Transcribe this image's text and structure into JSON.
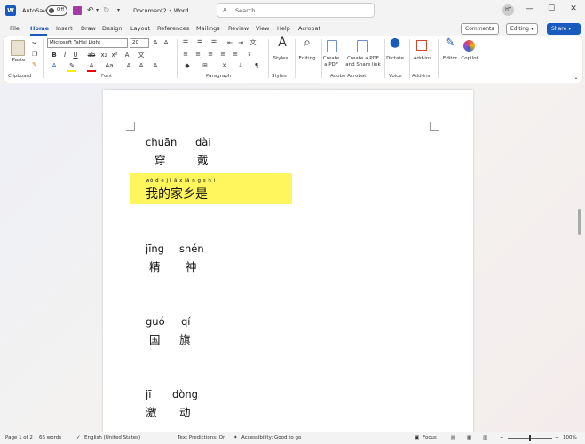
{
  "titlebar": {
    "autosave_label": "AutoSave",
    "autosave_state": "Off",
    "doc_title": "Document2 • Word",
    "search_placeholder": "Search",
    "user_initials": "HY",
    "minimize": "—",
    "restore": "☐",
    "close": "✕"
  },
  "tabs": [
    "File",
    "Home",
    "Insert",
    "Draw",
    "Design",
    "Layout",
    "References",
    "Mailings",
    "Review",
    "View",
    "Help",
    "Acrobat"
  ],
  "tabbar_buttons": {
    "comments": "Comments",
    "editing": "Editing",
    "share": "Share"
  },
  "ribbon": {
    "clipboard": {
      "paste": "Paste",
      "label": "Clipboard"
    },
    "font": {
      "name": "Microsoft YaHei Light",
      "size": "20",
      "label": "Font"
    },
    "paragraph": {
      "label": "Paragraph"
    },
    "styles": {
      "styles": "Styles",
      "label": "Styles"
    },
    "editing": {
      "editing": "Editing"
    },
    "acrobat": {
      "create_pdf_1": "Create",
      "create_pdf_2": "a PDF",
      "share_1": "Create a PDF",
      "share_2": "and Share link",
      "label": "Adobe Acrobat"
    },
    "voice": {
      "dictate": "Dictate",
      "label": "Voice"
    },
    "addins": {
      "addins": "Add-ins",
      "label": "Add-ins"
    },
    "editor": "Editor",
    "copilot": "Copilot"
  },
  "document": {
    "line1": {
      "pinyin": [
        "chuān",
        "dài"
      ],
      "hanzi": [
        "穿",
        "戴"
      ]
    },
    "ruby_line": {
      "ruby": "wǒ d e j i ā x iā n g s h ì",
      "text": "我的家乡是"
    },
    "line2": {
      "pinyin": [
        "jīng",
        "shén"
      ],
      "hanzi": [
        "精",
        "神"
      ]
    },
    "line3": {
      "pinyin": [
        "guó",
        "qí"
      ],
      "hanzi": [
        "国",
        "旗"
      ]
    },
    "line4": {
      "pinyin": [
        "jī",
        "dòng"
      ],
      "hanzi": [
        "激",
        "动"
      ]
    }
  },
  "statusbar": {
    "page": "Page 1 of 2",
    "words": "66 words",
    "language": "English (United States)",
    "predictions": "Text Predictions: On",
    "accessibility": "Accessibility: Good to go",
    "focus": "Focus",
    "zoom": "100%"
  },
  "colors": {
    "accent": "#185abd",
    "highlight": "#fff65e"
  }
}
